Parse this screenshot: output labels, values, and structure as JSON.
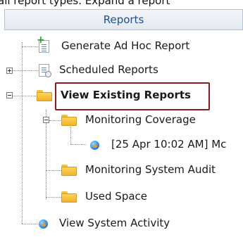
{
  "top_text": "all report types. Expand a report",
  "header": {
    "title": "Reports"
  },
  "tree": {
    "items": [
      {
        "label": "Generate Ad Hoc Report"
      },
      {
        "label": "Scheduled Reports"
      },
      {
        "label": "View Existing Reports"
      },
      {
        "label": "Monitoring Coverage"
      },
      {
        "label": "[25 Apr 10:02 AM] Mc"
      },
      {
        "label": "Monitoring System Audit"
      },
      {
        "label": "Used Space"
      },
      {
        "label": "View System Activity"
      }
    ]
  },
  "colors": {
    "header_text": "#1f4f91",
    "highlight_border": "#8e1b1b",
    "folder": "#f1b22a"
  }
}
